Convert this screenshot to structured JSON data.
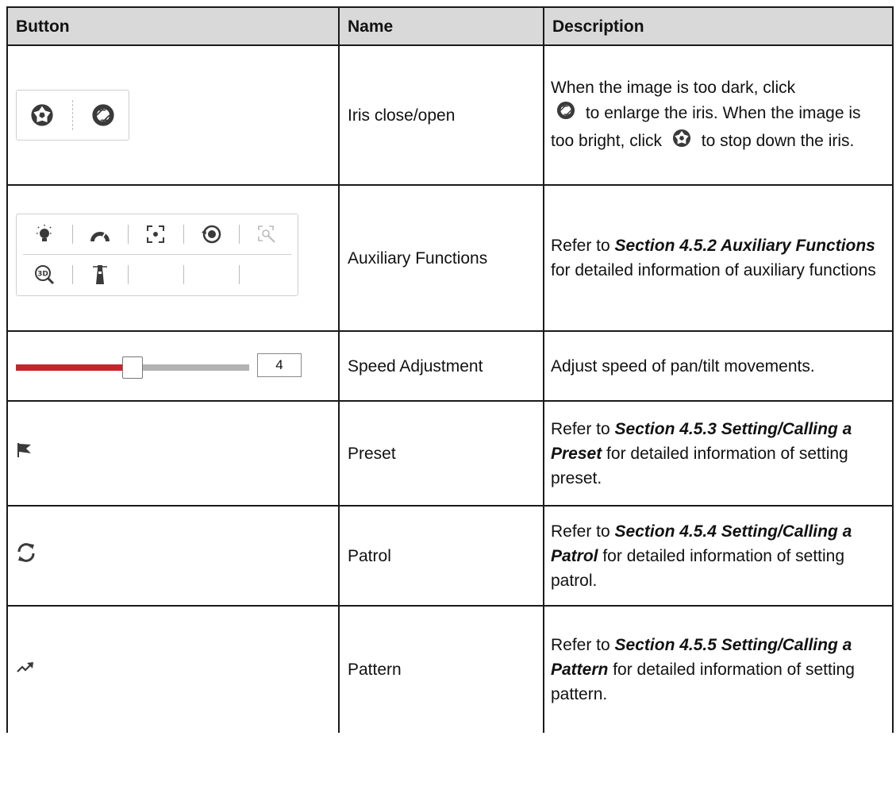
{
  "table": {
    "headers": [
      "Button",
      "Name",
      "Description"
    ],
    "rows": [
      {
        "name": "Iris close/open",
        "description": {
          "t1": "When the image is too dark, click",
          "t2": "to enlarge the iris. When the image is too bright, click",
          "t3": "to stop down the iris."
        },
        "icons": [
          "iris-close-icon",
          "iris-open-icon"
        ]
      },
      {
        "name": "Auxiliary Functions",
        "description": {
          "t1": "Refer to ",
          "b1": "Section 4.5.2 Auxiliary Functions",
          "t2": " for detailed information of auxiliary functions"
        },
        "icons": [
          "light-icon",
          "wiper-icon",
          "focus-icon",
          "initialize-lens-icon",
          "manual-tracking-icon",
          "3d-zoom-icon",
          "lighthouse-icon"
        ]
      },
      {
        "name": "Speed Adjustment",
        "description": "Adjust speed of pan/tilt movements.",
        "speed_value": "4",
        "speed_level_fraction": 0.5,
        "track_colors": {
          "filled": "#c8242c",
          "empty": "#b3b3b3"
        }
      },
      {
        "name": "Preset",
        "description": {
          "t1": "Refer to ",
          "b1": "Section 4.5.3 Setting/Calling a Preset",
          "t2": " for detailed information of setting preset."
        },
        "icon": "flag-icon"
      },
      {
        "name": "Patrol",
        "description": {
          "t1": "Refer to ",
          "b1": "Section 4.5.4 Setting/Calling a Patrol",
          "t2": " for detailed information of setting patrol."
        },
        "icon": "refresh-icon"
      },
      {
        "name": "Pattern",
        "description": {
          "t1": "Refer to ",
          "b1": "Section 4.5.5 Setting/Calling a Pattern",
          "t2": " for detailed information of setting pattern."
        },
        "icon": "trend-arrow-icon"
      }
    ]
  }
}
